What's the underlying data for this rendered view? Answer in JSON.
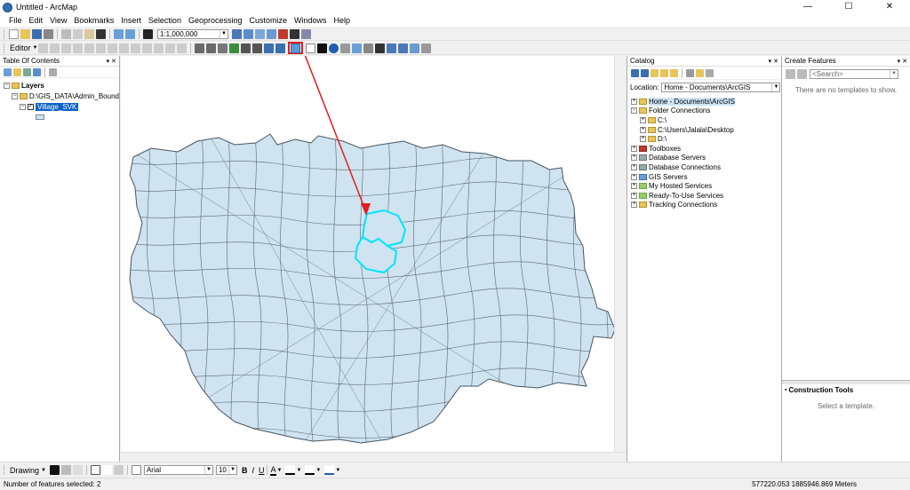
{
  "window": {
    "title": "Untitled - ArcMap",
    "controls": {
      "minimize": "—",
      "maximize": "☐",
      "close": "✕"
    }
  },
  "menubar": {
    "items": [
      "File",
      "Edit",
      "View",
      "Bookmarks",
      "Insert",
      "Selection",
      "Geoprocessing",
      "Customize",
      "Windows",
      "Help"
    ]
  },
  "standard_toolbar": {
    "scale": "1:1,000,000"
  },
  "editor_toolbar": {
    "label": "Editor"
  },
  "toc": {
    "title": "Table Of Contents",
    "tree": {
      "root": "Layers",
      "group": "D:\\GIS_DATA\\Admin_Bound",
      "layer": "Village_SVK"
    }
  },
  "catalog": {
    "title": "Catalog",
    "location_label": "Location:",
    "location_value": "Home - Documents\\ArcGIS",
    "items": [
      "Home - Documents\\ArcGIS",
      "Folder Connections",
      "C:\\",
      "C:\\Users\\Jalala\\Desktop",
      "D:\\",
      "Toolboxes",
      "Database Servers",
      "Database Connections",
      "GIS Servers",
      "My Hosted Services",
      "Ready-To-Use Services",
      "Tracking Connections"
    ]
  },
  "create_features": {
    "title": "Create Features",
    "search_placeholder": "<Search>",
    "empty_message": "There are no templates to show.",
    "construction_title": "Construction Tools",
    "construction_message": "Select a template."
  },
  "drawing_toolbar": {
    "label": "Drawing",
    "font": "Arial",
    "font_size": "10",
    "bold": "B",
    "italic": "I",
    "underline": "U",
    "font_color_glyph": "A"
  },
  "status": {
    "selection": "Number of features selected: 2",
    "coordinates": "577220.053  1885946.869 Meters"
  },
  "colors": {
    "accent": "#0a64c8",
    "highlight": "#00e5ff",
    "polygon_fill": "#cfe3f0",
    "annotation": "#e31c1c"
  }
}
